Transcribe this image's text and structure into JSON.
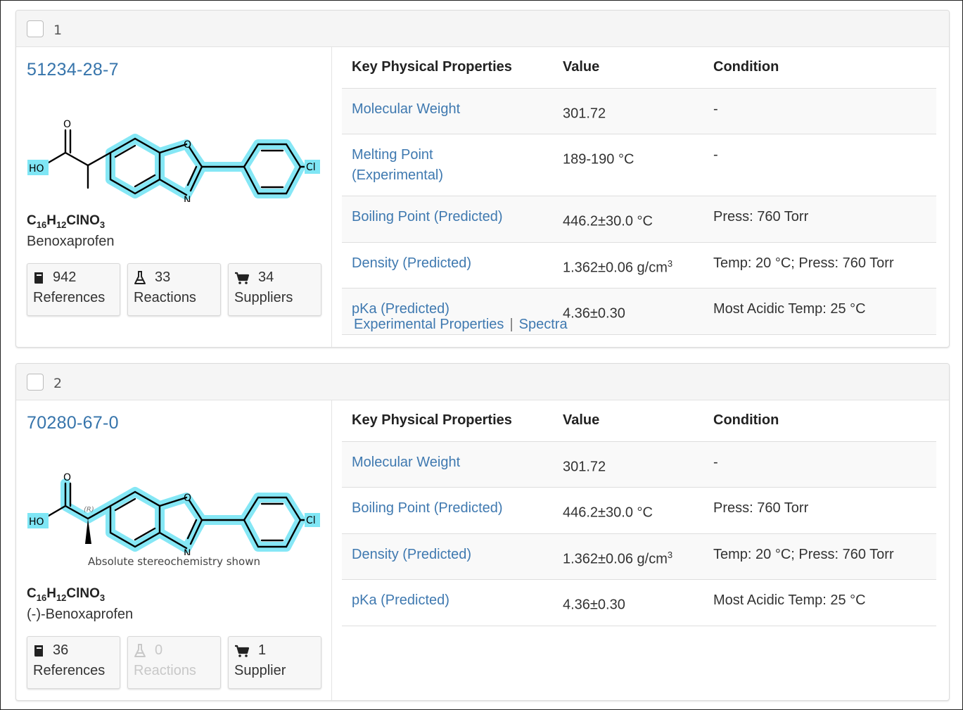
{
  "records": [
    {
      "index": "1",
      "cas": "51234-28-7",
      "formula": {
        "c": "C",
        "c_n": "16",
        "h": "H",
        "h_n": "12",
        "rest": "ClNO",
        "o_n": "3"
      },
      "name": "Benoxaprofen",
      "stereo_note": "",
      "structure_labels": {
        "o_carbonyl": "O",
        "ho": "HO",
        "o_ring": "O",
        "n_ring": "N",
        "cl": "Cl",
        "r": ""
      },
      "stats": [
        {
          "icon": "book-icon",
          "count": "942",
          "label": "References",
          "disabled": false
        },
        {
          "icon": "flask-icon",
          "count": "33",
          "label": "Reactions",
          "disabled": false
        },
        {
          "icon": "cart-icon",
          "count": "34",
          "label": "Suppliers",
          "disabled": false
        }
      ],
      "table_headers": {
        "property": "Key Physical Properties",
        "value": "Value",
        "condition": "Condition"
      },
      "properties": [
        {
          "name": "Molecular Weight",
          "value": "301.72",
          "sup": "",
          "condition": "-"
        },
        {
          "name": "Melting Point (Experimental)",
          "value": "189-190 °C",
          "sup": "",
          "condition": "-"
        },
        {
          "name": "Boiling Point (Predicted)",
          "value": "446.2±30.0 °C",
          "sup": "",
          "condition": "Press: 760 Torr"
        },
        {
          "name": "Density (Predicted)",
          "value": "1.362±0.06 g/cm",
          "sup": "3",
          "condition": "Temp: 20 °C; Press: 760 Torr"
        },
        {
          "name": "pKa (Predicted)",
          "value": "4.36±0.30",
          "sup": "",
          "condition": "Most Acidic Temp: 25 °C"
        }
      ],
      "links": {
        "experimental": "Experimental Properties",
        "separator": "|",
        "spectra": "Spectra"
      }
    },
    {
      "index": "2",
      "cas": "70280-67-0",
      "formula": {
        "c": "C",
        "c_n": "16",
        "h": "H",
        "h_n": "12",
        "rest": "ClNO",
        "o_n": "3"
      },
      "name": "(-)-Benoxaprofen",
      "stereo_note": "Absolute stereochemistry shown",
      "structure_labels": {
        "o_carbonyl": "O",
        "ho": "HO",
        "o_ring": "O",
        "n_ring": "N",
        "cl": "Cl",
        "r": "(R)"
      },
      "stats": [
        {
          "icon": "book-icon",
          "count": "36",
          "label": "References",
          "disabled": false
        },
        {
          "icon": "flask-icon",
          "count": "0",
          "label": "Reactions",
          "disabled": true
        },
        {
          "icon": "cart-icon",
          "count": "1",
          "label": "Supplier",
          "disabled": false
        }
      ],
      "table_headers": {
        "property": "Key Physical Properties",
        "value": "Value",
        "condition": "Condition"
      },
      "properties": [
        {
          "name": "Molecular Weight",
          "value": "301.72",
          "sup": "",
          "condition": "-"
        },
        {
          "name": "Boiling Point (Predicted)",
          "value": "446.2±30.0 °C",
          "sup": "",
          "condition": "Press: 760 Torr"
        },
        {
          "name": "Density (Predicted)",
          "value": "1.362±0.06 g/cm",
          "sup": "3",
          "condition": "Temp: 20 °C; Press: 760 Torr"
        },
        {
          "name": "pKa (Predicted)",
          "value": "4.36±0.30",
          "sup": "",
          "condition": "Most Acidic Temp: 25 °C"
        }
      ],
      "links": null
    }
  ],
  "colors": {
    "link": "#3f79b0",
    "cas": "#3674ab",
    "highlight": "#7fe6f5"
  }
}
